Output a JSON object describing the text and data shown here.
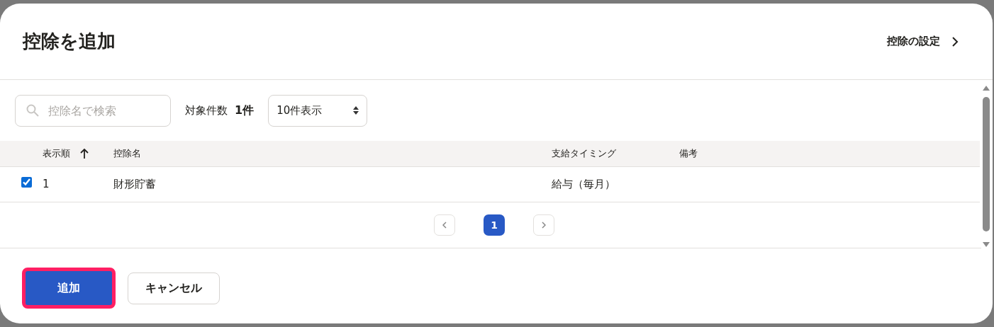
{
  "dialog": {
    "title": "控除を追加",
    "settings_link": "控除の設定"
  },
  "toolbar": {
    "search": {
      "placeholder": "控除名で検索"
    },
    "count_label": "対象件数",
    "count": "1件",
    "page_size": "10件表示"
  },
  "table": {
    "columns": [
      {
        "label": "表示順",
        "sorted": true
      },
      {
        "label": "控除名",
        "sorted": false
      },
      {
        "label": "支給タイミング",
        "sorted": false
      },
      {
        "label": "備考",
        "sorted": false
      }
    ],
    "rows": [
      {
        "checked": true,
        "cells": [
          "1",
          "財形貯蓄",
          "給与（毎月）"
        ]
      }
    ]
  },
  "pagination": {
    "pages": [
      {
        "label": "1",
        "selected": true
      }
    ]
  },
  "buttons": [
    {
      "label": "追加",
      "kind": "primary",
      "highlighted": true
    },
    {
      "label": "キャンセル",
      "kind": "secondary",
      "highlighted": false
    }
  ]
}
